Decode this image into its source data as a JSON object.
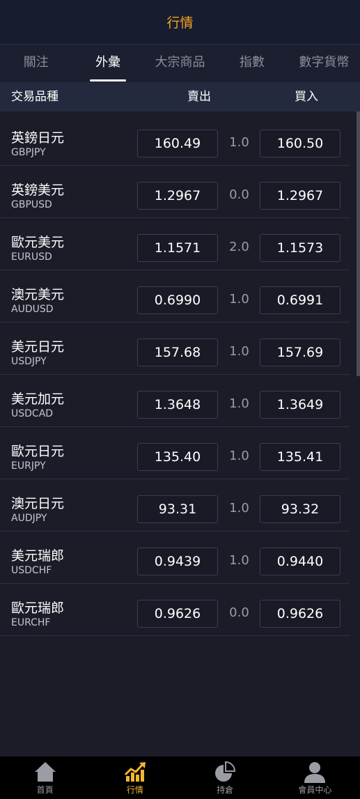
{
  "header": {
    "title": "行情"
  },
  "tabs": [
    {
      "label": "關注",
      "active": false
    },
    {
      "label": "外彙",
      "active": true
    },
    {
      "label": "大宗商品",
      "active": false
    },
    {
      "label": "指數",
      "active": false
    },
    {
      "label": "數字貨幣",
      "active": false
    }
  ],
  "table_header": {
    "name": "交易品種",
    "sell": "賣出",
    "buy": "買入"
  },
  "rows": [
    {
      "name": "英鎊日元",
      "code": "GBPJPY",
      "sell": "160.49",
      "spread": "1.0",
      "buy": "160.50"
    },
    {
      "name": "英鎊美元",
      "code": "GBPUSD",
      "sell": "1.2967",
      "spread": "0.0",
      "buy": "1.2967"
    },
    {
      "name": "歐元美元",
      "code": "EURUSD",
      "sell": "1.1571",
      "spread": "2.0",
      "buy": "1.1573"
    },
    {
      "name": "澳元美元",
      "code": "AUDUSD",
      "sell": "0.6990",
      "spread": "1.0",
      "buy": "0.6991"
    },
    {
      "name": "美元日元",
      "code": "USDJPY",
      "sell": "157.68",
      "spread": "1.0",
      "buy": "157.69"
    },
    {
      "name": "美元加元",
      "code": "USDCAD",
      "sell": "1.3648",
      "spread": "1.0",
      "buy": "1.3649"
    },
    {
      "name": "歐元日元",
      "code": "EURJPY",
      "sell": "135.40",
      "spread": "1.0",
      "buy": "135.41"
    },
    {
      "name": "澳元日元",
      "code": "AUDJPY",
      "sell": "93.31",
      "spread": "1.0",
      "buy": "93.32"
    },
    {
      "name": "美元瑞郎",
      "code": "USDCHF",
      "sell": "0.9439",
      "spread": "1.0",
      "buy": "0.9440"
    },
    {
      "name": "歐元瑞郎",
      "code": "EURCHF",
      "sell": "0.9626",
      "spread": "0.0",
      "buy": "0.9626"
    }
  ],
  "bottom_nav": [
    {
      "label": "首頁",
      "icon": "home-icon",
      "active": false
    },
    {
      "label": "行情",
      "icon": "chart-trend-icon",
      "active": true
    },
    {
      "label": "持倉",
      "icon": "pie-chart-icon",
      "active": false
    },
    {
      "label": "會員中心",
      "icon": "user-icon",
      "active": false
    }
  ],
  "colors": {
    "accent": "#f5a623",
    "background": "#1c1c29",
    "header": "#171c2f"
  }
}
